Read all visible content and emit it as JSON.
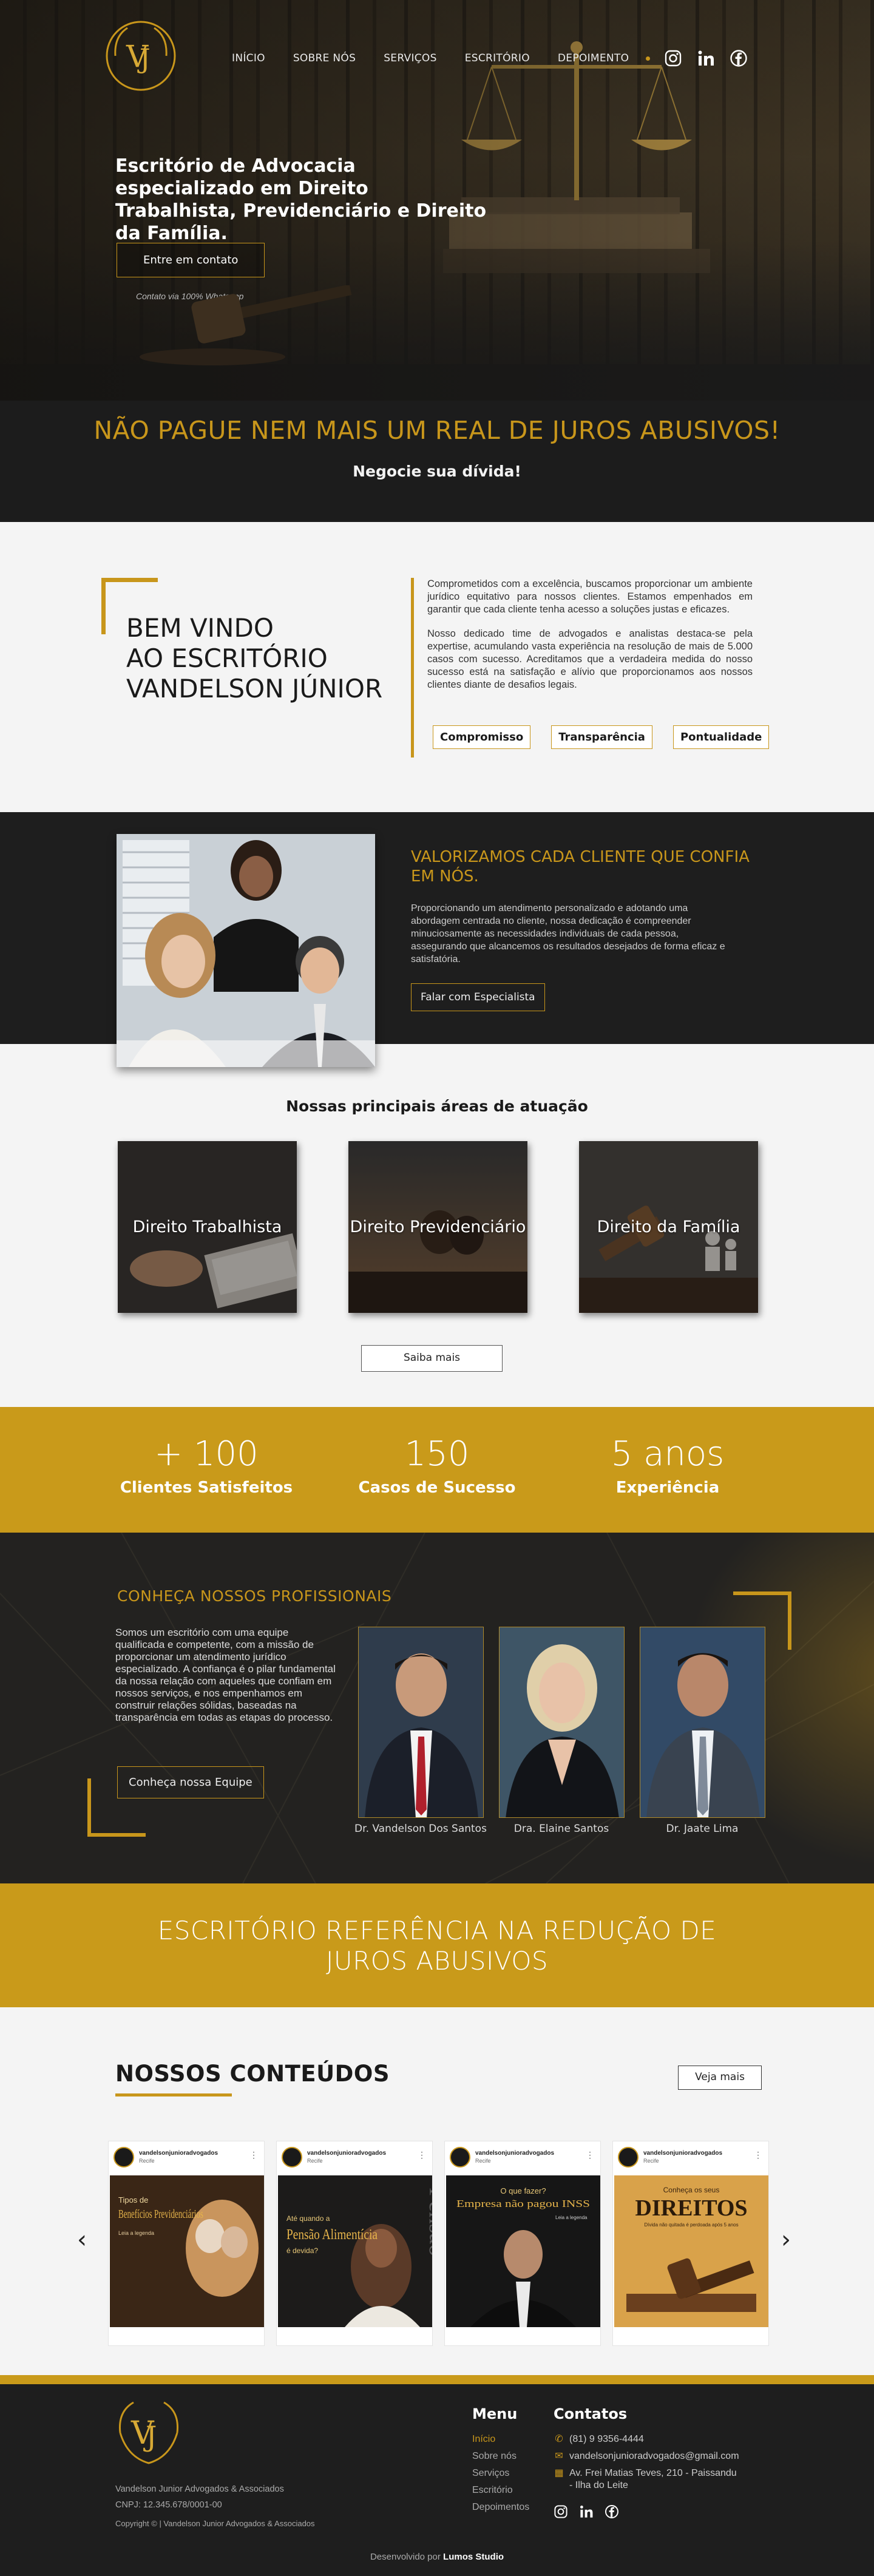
{
  "nav": {
    "items": [
      "INÍCIO",
      "SOBRE NÓS",
      "SERVIÇOS",
      "ESCRITÓRIO",
      "DEPOIMENTO"
    ],
    "social": [
      "instagram-icon",
      "linkedin-icon",
      "facebook-icon"
    ]
  },
  "hero": {
    "title": "Escritório de Advocacia especializado em Direito Trabalhista, Previdenciário e Direito da Família.",
    "cta": "Entre em contato",
    "cta_note": "Contato via 100% Whatsapp",
    "promo": "NÃO PAGUE NEM MAIS UM REAL DE JUROS ABUSIVOS!",
    "promo_sub": "Negocie sua dívida!"
  },
  "welcome": {
    "line1": "BEM VINDO",
    "line2": "AO ESCRITÓRIO",
    "line3": "VANDELSON JÚNIOR",
    "p1": "Comprometidos com a excelência, buscamos proporcionar um ambiente jurídico equitativo para nossos clientes. Estamos empenhados em garantir que cada cliente tenha acesso a soluções justas e eficazes.",
    "p2": "Nosso dedicado time de advogados e analistas destaca-se pela expertise, acumulando vasta experiência na resolução de mais de 5.000 casos com sucesso. Acreditamos que a verdadeira medida do nosso sucesso está na satisfação e alívio que proporcionamos aos nossos clientes diante de desafios legais.",
    "pills": [
      "Compromisso",
      "Transparência",
      "Pontualidade"
    ]
  },
  "value": {
    "title": "VALORIZAMOS CADA CLIENTE QUE CONFIA EM NÓS.",
    "text": "Proporcionando um atendimento personalizado e adotando uma abordagem centrada no cliente, nossa dedicação é compreender minuciosamente as necessidades individuais de cada pessoa, assegurando que alcancemos os resultados desejados de forma eficaz e satisfatória.",
    "button": "Falar com Especialista"
  },
  "areas": {
    "title": "Nossas principais áreas de atuação",
    "cards": [
      "Direito Trabalhista",
      "Direito Previdenciário",
      "Direito da Família"
    ],
    "more": "Saiba mais"
  },
  "stats": [
    {
      "num": "+ 100",
      "label": "Clientes Satisfeitos"
    },
    {
      "num": "150",
      "label": "Casos de Sucesso"
    },
    {
      "num": "5 anos",
      "label": "Experiência"
    }
  ],
  "team": {
    "title": "CONHEÇA NOSSOS PROFISSIONAIS",
    "text": "Somos um escritório com uma equipe qualificada e competente, com a missão de proporcionar um atendimento jurídico especializado. A confiança é o pilar fundamental da nossa relação com aqueles que confiam em nossos serviços, e nos empenhamos em construir relações sólidas, baseadas na transparência em todas as etapas do processo.",
    "button": "Conheça nossa Equipe",
    "members": [
      "Dr. Vandelson Dos Santos",
      "Dra. Elaine Santos",
      "Dr. Jaate Lima"
    ]
  },
  "banner": {
    "line1": "ESCRITÓRIO REFERÊNCIA NA REDUÇÃO DE",
    "line2": "JUROS ABUSIVOS"
  },
  "contents": {
    "title": "NOSSOS CONTEÚDOS",
    "more": "Veja mais",
    "handle": "vandelsonjunioradvogados",
    "location": "Recife",
    "posts": [
      {
        "small": "Tipos de",
        "big": "Benefícios Previdenciários",
        "foot": "Leia a legenda"
      },
      {
        "small": "Até quando a",
        "big": "Pensão Alimentícia",
        "foot": "é devida?",
        "side": "Pensão"
      },
      {
        "small": "O que fazer?",
        "big": "Empresa não pagou INSS",
        "foot": "Leia a legenda"
      },
      {
        "small": "Conheça os seus",
        "big": "DIREITOS",
        "foot": "Dívida não quitada é perdoada após 5 anos"
      }
    ]
  },
  "footer": {
    "firm": "Vandelson Junior Advogados & Associados",
    "cnpj": "CNPJ: 12.345.678/0001-00",
    "copy": "Copyright © | Vandelson Junior Advogados & Associados",
    "menu_title": "Menu",
    "menu": [
      "Início",
      "Sobre nós",
      "Serviços",
      "Escritório",
      "Depoimentos"
    ],
    "contact_title": "Contatos",
    "phone": "(81) 9 9356-4444",
    "email": "vandelsonjunioradvogados@gmail.com",
    "address1": "Av. Frei Matias Teves, 210 - Paissandu",
    "address2": "- Ilha do Leite",
    "dev_prefix": "Desenvolvido por",
    "dev_name": "Lumos Studio"
  },
  "colors": {
    "gold": "#c8961b",
    "dark": "#1e1e1e",
    "light": "#f4f4f4"
  }
}
